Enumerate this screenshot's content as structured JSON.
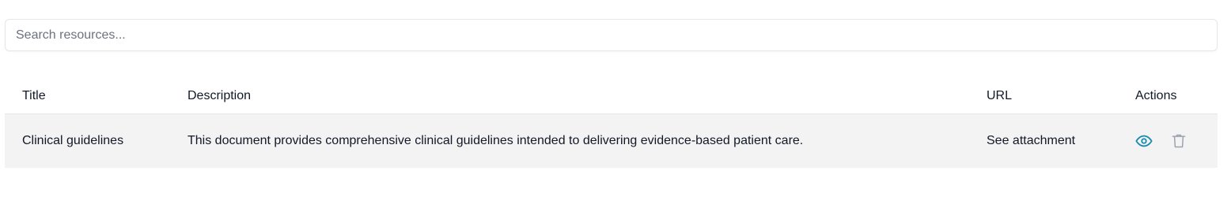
{
  "search": {
    "placeholder": "Search resources...",
    "value": ""
  },
  "table": {
    "columns": [
      "Title",
      "Description",
      "URL",
      "Actions"
    ],
    "rows": [
      {
        "title": "Clinical guidelines",
        "description": "This document provides comprehensive clinical guidelines intended to delivering evidence-based patient care.",
        "url": "See attachment",
        "actions": [
          "eye-icon",
          "trash-icon"
        ]
      }
    ]
  },
  "colors": {
    "view_icon": "#1a8cb0",
    "delete_icon": "#9ca3af",
    "row_background": "#f3f3f3",
    "border": "#e5e7eb"
  }
}
